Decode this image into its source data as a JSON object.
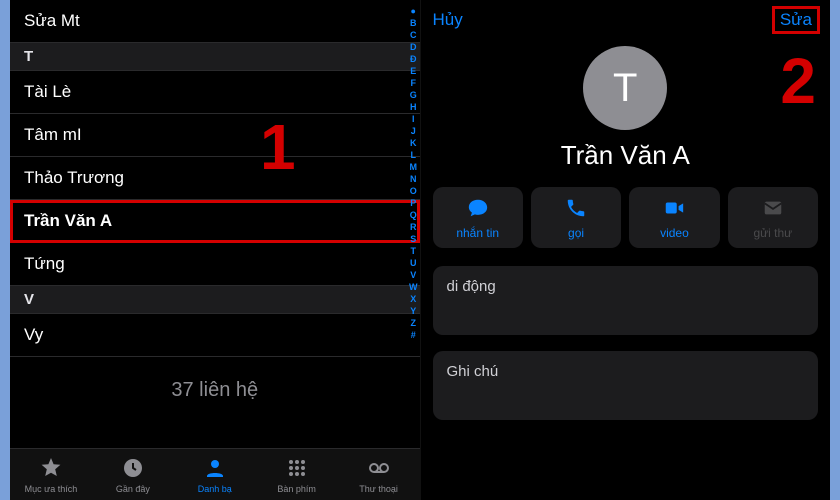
{
  "left": {
    "topRow": "Sửa Mt",
    "sections": [
      {
        "letter": "T",
        "rows": [
          "Tài Lè",
          "Tâm mI",
          "Thảo Trương",
          "Trần Văn A",
          "Tứng"
        ],
        "selected": "Trần Văn A"
      },
      {
        "letter": "V",
        "rows": [
          "Vy"
        ]
      }
    ],
    "count": "37 liên hệ",
    "alphaIndex": [
      "●",
      "B",
      "C",
      "D",
      "Đ",
      "E",
      "F",
      "G",
      "H",
      "I",
      "J",
      "K",
      "L",
      "M",
      "N",
      "O",
      "P",
      "Q",
      "R",
      "S",
      "T",
      "U",
      "V",
      "W",
      "X",
      "Y",
      "Z",
      "#"
    ],
    "tabs": [
      {
        "id": "favorites",
        "label": "Mục ưa thích"
      },
      {
        "id": "recents",
        "label": "Gần đây"
      },
      {
        "id": "contacts",
        "label": "Danh bạ"
      },
      {
        "id": "keypad",
        "label": "Bàn phím"
      },
      {
        "id": "voicemail",
        "label": "Thư thoại"
      }
    ],
    "activeTab": "contacts"
  },
  "right": {
    "cancel": "Hủy",
    "edit": "Sửa",
    "avatarInitial": "T",
    "name": "Trần Văn A",
    "actions": [
      {
        "id": "message",
        "label": "nhắn tin",
        "enabled": true
      },
      {
        "id": "call",
        "label": "gọi",
        "enabled": true
      },
      {
        "id": "video",
        "label": "video",
        "enabled": true
      },
      {
        "id": "mail",
        "label": "gửi thư",
        "enabled": false
      }
    ],
    "mobileLabel": "di động",
    "notesLabel": "Ghi chú"
  },
  "annotations": {
    "one": "1",
    "two": "2"
  }
}
